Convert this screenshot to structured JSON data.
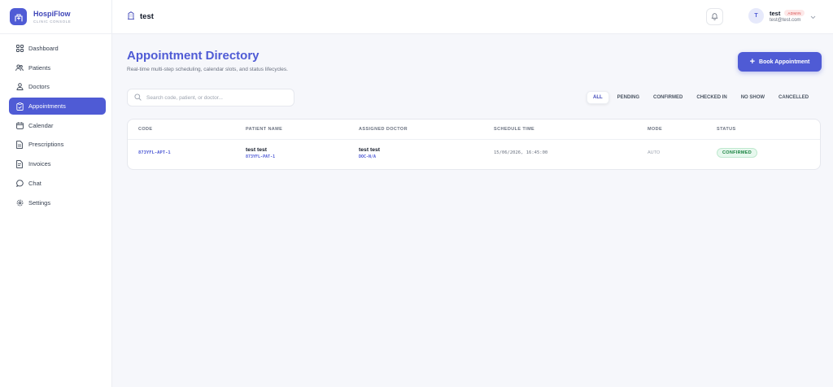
{
  "brand": {
    "name": "HospiFlow",
    "subtitle": "CLINIC CONSOLE"
  },
  "nav": {
    "items": [
      {
        "label": "Dashboard",
        "icon": "grid-icon"
      },
      {
        "label": "Patients",
        "icon": "users-icon"
      },
      {
        "label": "Doctors",
        "icon": "stethoscope-icon"
      },
      {
        "label": "Appointments",
        "icon": "clipboard-icon",
        "active": true
      },
      {
        "label": "Calendar",
        "icon": "calendar-icon"
      },
      {
        "label": "Prescriptions",
        "icon": "document-icon"
      },
      {
        "label": "Invoices",
        "icon": "receipt-icon"
      },
      {
        "label": "Chat",
        "icon": "chat-icon"
      },
      {
        "label": "Settings",
        "icon": "gear-icon"
      }
    ]
  },
  "topbar": {
    "workspace": "test",
    "user": {
      "initial": "T",
      "name": "test",
      "role": "ADMIN",
      "email": "test@test.com"
    }
  },
  "page": {
    "title": "Appointment Directory",
    "subtitle": "Real-time multi-step scheduling, calendar slots, and status lifecycles.",
    "book_button": "Book Appointment"
  },
  "search": {
    "placeholder": "Search code, patient, or doctor...",
    "value": ""
  },
  "filters": [
    "ALL",
    "PENDING",
    "CONFIRMED",
    "CHECKED IN",
    "NO SHOW",
    "CANCELLED"
  ],
  "active_filter": "ALL",
  "table": {
    "columns": [
      "CODE",
      "PATIENT NAME",
      "ASSIGNED DOCTOR",
      "SCHEDULE TIME",
      "MODE",
      "STATUS"
    ],
    "rows": [
      {
        "code": "873YFL-APT-1",
        "patient_name": "test test",
        "patient_code": "873YFL-PAT-1",
        "doctor_name": "test test",
        "doctor_code": "DOC-N/A",
        "schedule_time": "15/06/2026, 16:45:00",
        "mode": "AUTO",
        "status": "CONFIRMED"
      }
    ]
  },
  "colors": {
    "accent": "#4f5bd5",
    "status_confirmed": "#15803d",
    "admin_badge": "#d64545"
  }
}
